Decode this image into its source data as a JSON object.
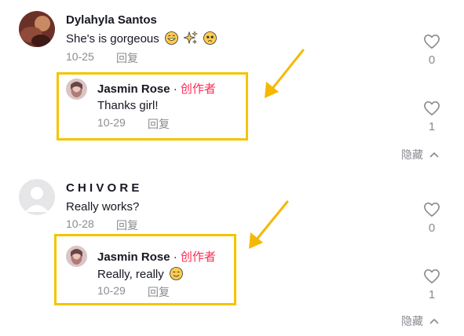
{
  "comments": [
    {
      "author": "Dylahyla Santos",
      "text": "She's is gorgeous",
      "date": "10-25",
      "reply_label": "回复",
      "likes": "0",
      "reply": {
        "author": "Jasmin Rose",
        "separator": " · ",
        "badge": "创作者",
        "text": "Thanks girl!",
        "date": "10-29",
        "reply_label": "回复",
        "likes": "1"
      },
      "hide_label": "隐藏"
    },
    {
      "author": "C H I V O R E",
      "text": "Really works?",
      "date": "10-28",
      "reply_label": "回复",
      "likes": "0",
      "reply": {
        "author": "Jasmin Rose",
        "separator": " · ",
        "badge": "创作者",
        "text": "Really, really",
        "date": "10-29",
        "reply_label": "回复",
        "likes": "1"
      },
      "hide_label": "隐藏"
    }
  ],
  "colors": {
    "creator_badge": "#fe2c55",
    "highlight_box": "#f5c400",
    "arrow": "#f5b800",
    "meta": "#8a8b91"
  }
}
